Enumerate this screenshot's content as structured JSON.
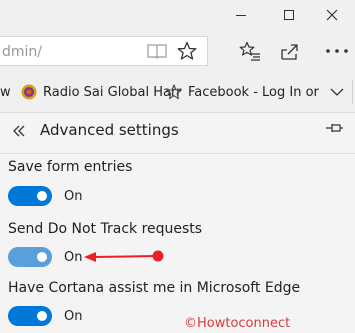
{
  "address_bar": {
    "url": "dmin/"
  },
  "favorites": [
    {
      "label": "w",
      "icon": "page-icon"
    },
    {
      "label": "Radio Sai Global Harr",
      "icon": "sai-logo-icon"
    },
    {
      "label": "Facebook - Log In or",
      "icon": "star-outline-icon"
    }
  ],
  "panel": {
    "title": "Advanced settings",
    "settings": [
      {
        "label": "Save form entries",
        "state": "On",
        "on": true
      },
      {
        "label": "Send Do Not Track requests",
        "state": "On",
        "on": true
      },
      {
        "label": "Have Cortana assist me in Microsoft Edge",
        "state": "On",
        "on": true
      }
    ]
  },
  "watermark": "©Howtoconnect",
  "colors": {
    "toggle_on": "#0078d7",
    "toggle_hover": "#5a9fdb",
    "arrow": "#e8202a",
    "chrome_bg": "#f0f0f0"
  }
}
